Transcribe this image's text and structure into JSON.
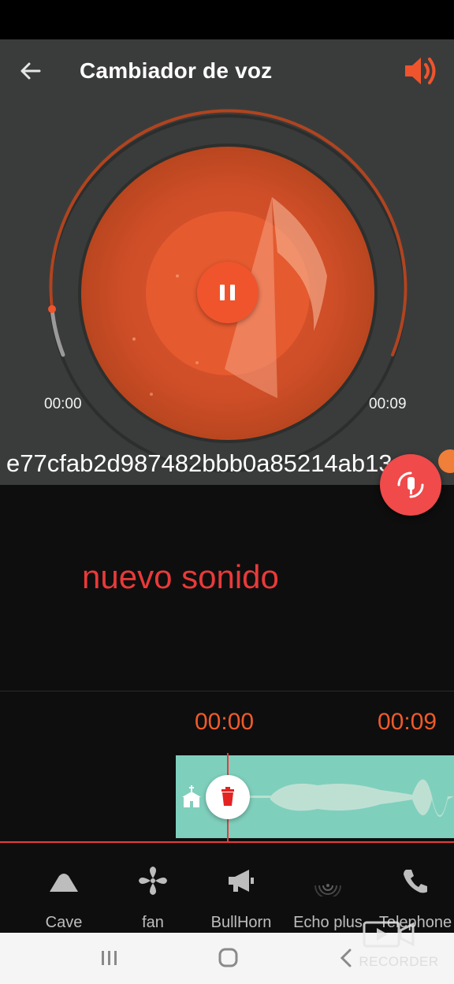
{
  "header": {
    "title": "Cambiador de voz",
    "back_icon": "arrow-left-icon",
    "volume_icon": "volume-icon"
  },
  "player": {
    "time_elapsed": "00:00",
    "time_total": "00:09",
    "progress": 0,
    "file_name": "e77cfab2d987482bbb0a85214ab13",
    "state": "playing"
  },
  "overlay": {
    "text": "nuevo sonido"
  },
  "timeline": {
    "start": "00:00",
    "end": "00:09"
  },
  "effects": [
    {
      "label": "Cave",
      "icon": "mountain-icon"
    },
    {
      "label": "fan",
      "icon": "fan-icon"
    },
    {
      "label": "BullHorn",
      "icon": "megaphone-icon"
    },
    {
      "label": "Echo plus",
      "icon": "echo-icon"
    },
    {
      "label": "Telephone",
      "icon": "phone-icon"
    }
  ],
  "watermark": {
    "text": "RECORDER"
  },
  "colors": {
    "accent": "#f0542d",
    "overlay_red": "#e83a3a",
    "panel": "#3a3c3b",
    "waveform": "#7fcfbd"
  }
}
